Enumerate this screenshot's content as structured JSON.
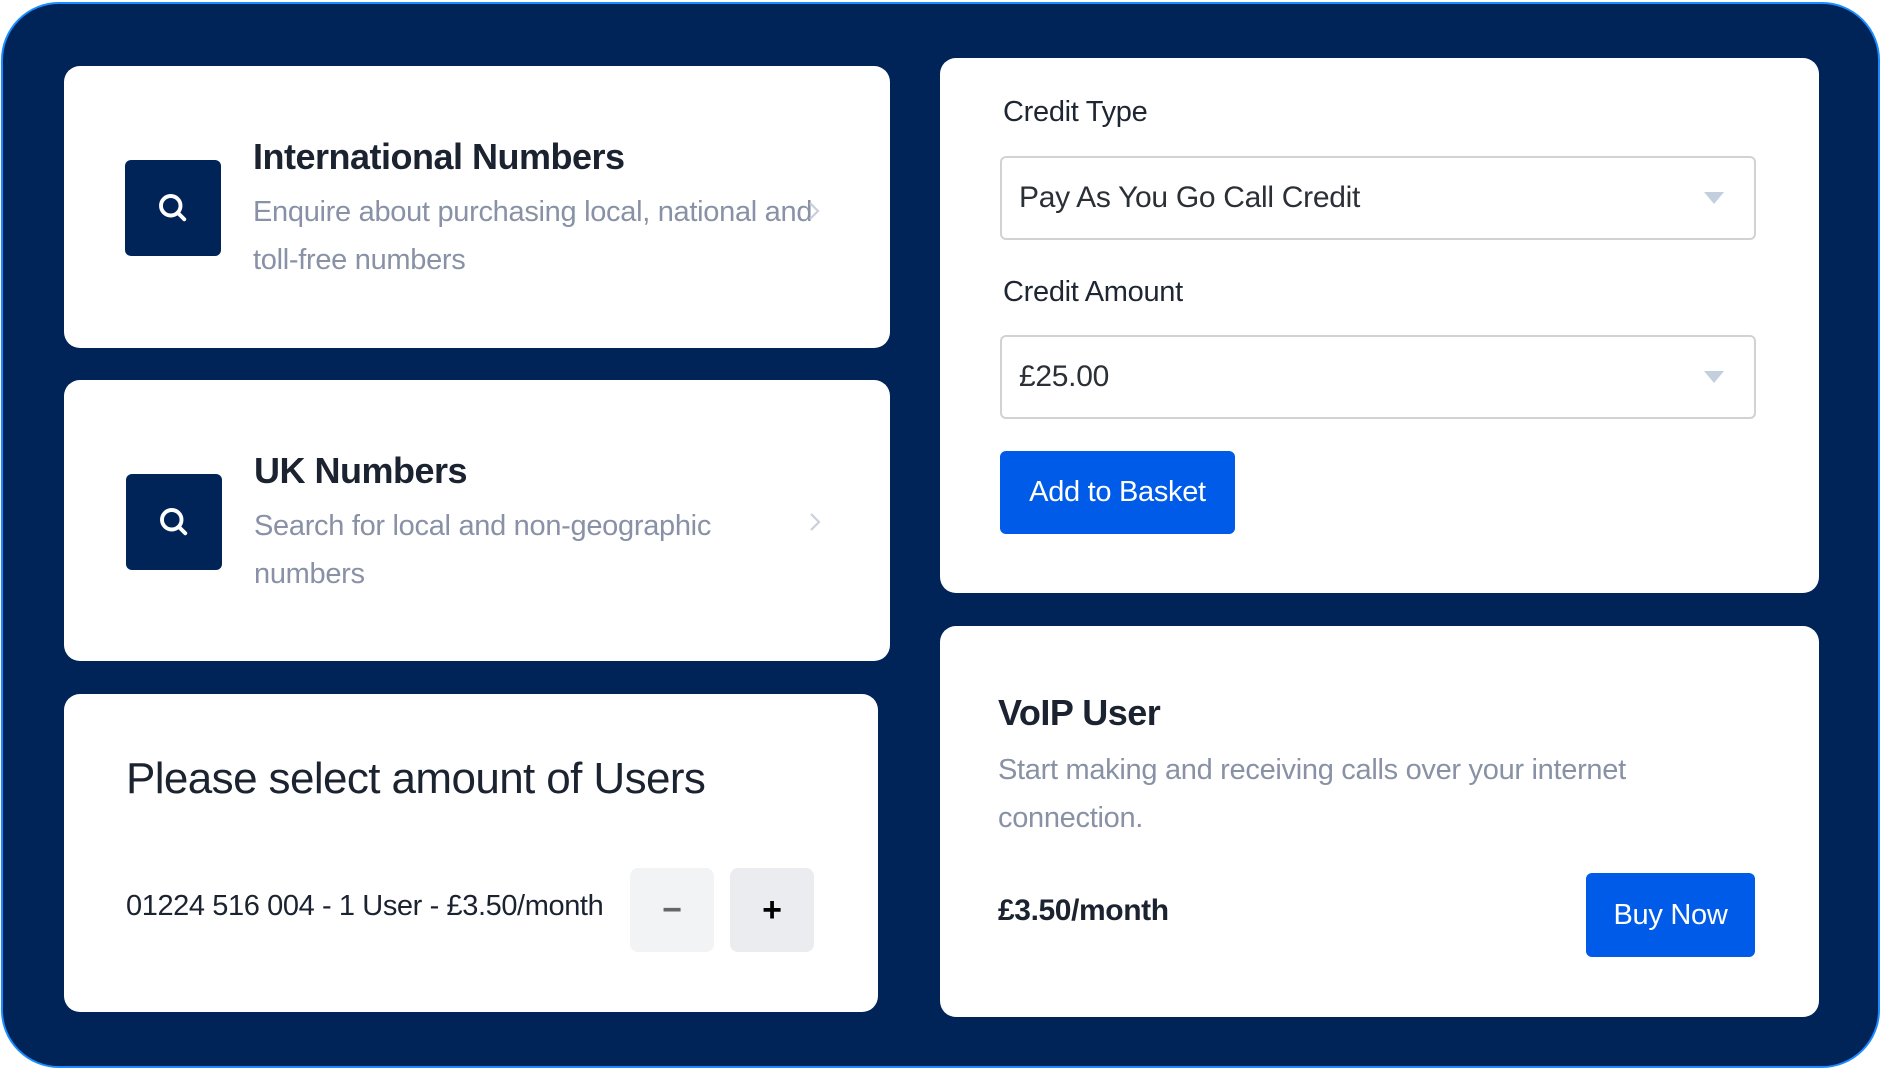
{
  "cards": {
    "international": {
      "icon": "search-icon",
      "title": "International Numbers",
      "description": "Enquire about purchasing local, national and toll-free numbers",
      "chevron": "chevron-right-icon"
    },
    "uk": {
      "icon": "search-icon",
      "title": "UK Numbers",
      "description": "Search for local and non-geographic numbers",
      "chevron": "chevron-right-icon"
    },
    "users": {
      "title": "Please select amount of Users",
      "line": "01224 516 004 - 1 User - £3.50/month",
      "decrement_label": "−",
      "increment_label": "+",
      "quantity": 1
    },
    "credit": {
      "type_label": "Credit Type",
      "type_value": "Pay As You Go Call Credit",
      "amount_label": "Credit Amount",
      "amount_value": "£25.00",
      "add_button": "Add to Basket"
    },
    "voip": {
      "title": "VoIP User",
      "description": "Start making and receiving calls over your internet connection.",
      "price": "£3.50/month",
      "buy_button": "Buy Now"
    }
  },
  "colors": {
    "frame_bg": "#002458",
    "frame_border": "#1a8cff",
    "accent": "#005be8",
    "muted_text": "#8891a5"
  }
}
